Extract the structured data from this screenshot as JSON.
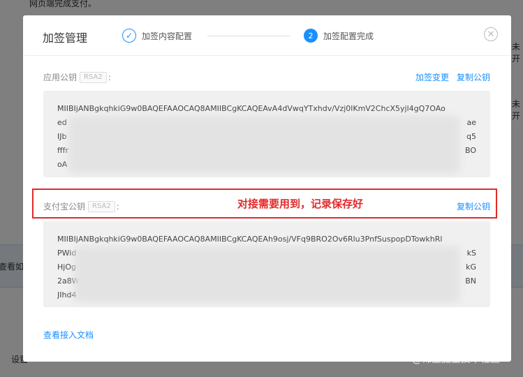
{
  "background": {
    "top_text": "网页端完成支付。",
    "right_text_1": "未开",
    "right_text_2": "未开",
    "band_left_text": "查看如",
    "bottom_left_text": "设置"
  },
  "modal": {
    "title": "加签管理",
    "steps": [
      {
        "label": "加签内容配置",
        "state": "done"
      },
      {
        "number": "2",
        "label": "加签配置完成",
        "state": "active"
      }
    ],
    "close_symbol": "✕"
  },
  "app_key": {
    "label": "应用公钥",
    "badge": "RSA2",
    "colon": ":",
    "action_change": "加签变更",
    "action_copy": "复制公钥",
    "lines": [
      "MIIBIjANBgkqhkiG9w0BAQEFAAOCAQ8AMIIBCgKCAQEAvA4dVwqYTxhdv/Vzj0lKmV2ChcX5yjl4gQ7OAo",
      "ed",
      "IJb",
      "fffr",
      "oA"
    ],
    "line_suffixes": [
      "",
      "ae",
      "q5",
      "BO",
      ""
    ]
  },
  "alipay_key": {
    "label": "支付宝公钥",
    "badge": "RSA2",
    "colon": ":",
    "action_copy": "复制公钥",
    "annotation": "对接需要用到，记录保存好",
    "lines": [
      "MIIBIjANBgkqhkiG9w0BAQEFAAOCAQ8AMIIBCgKCAQEAh9osj/VFq9BRO2Ov6Rlu3PnfSuspopDTowkhRl",
      "PWid",
      "HjOg",
      "2a8W",
      "JIhd4"
    ],
    "line_suffixes": [
      "",
      "kS",
      "kG",
      "BN",
      ""
    ]
  },
  "docs_link": "查看接入文档",
  "watermark": "@稀土掘金技术社区",
  "colors": {
    "accent": "#1890ff",
    "annotation_red": "#e02a2a",
    "key_bg": "#f0f0f0"
  }
}
